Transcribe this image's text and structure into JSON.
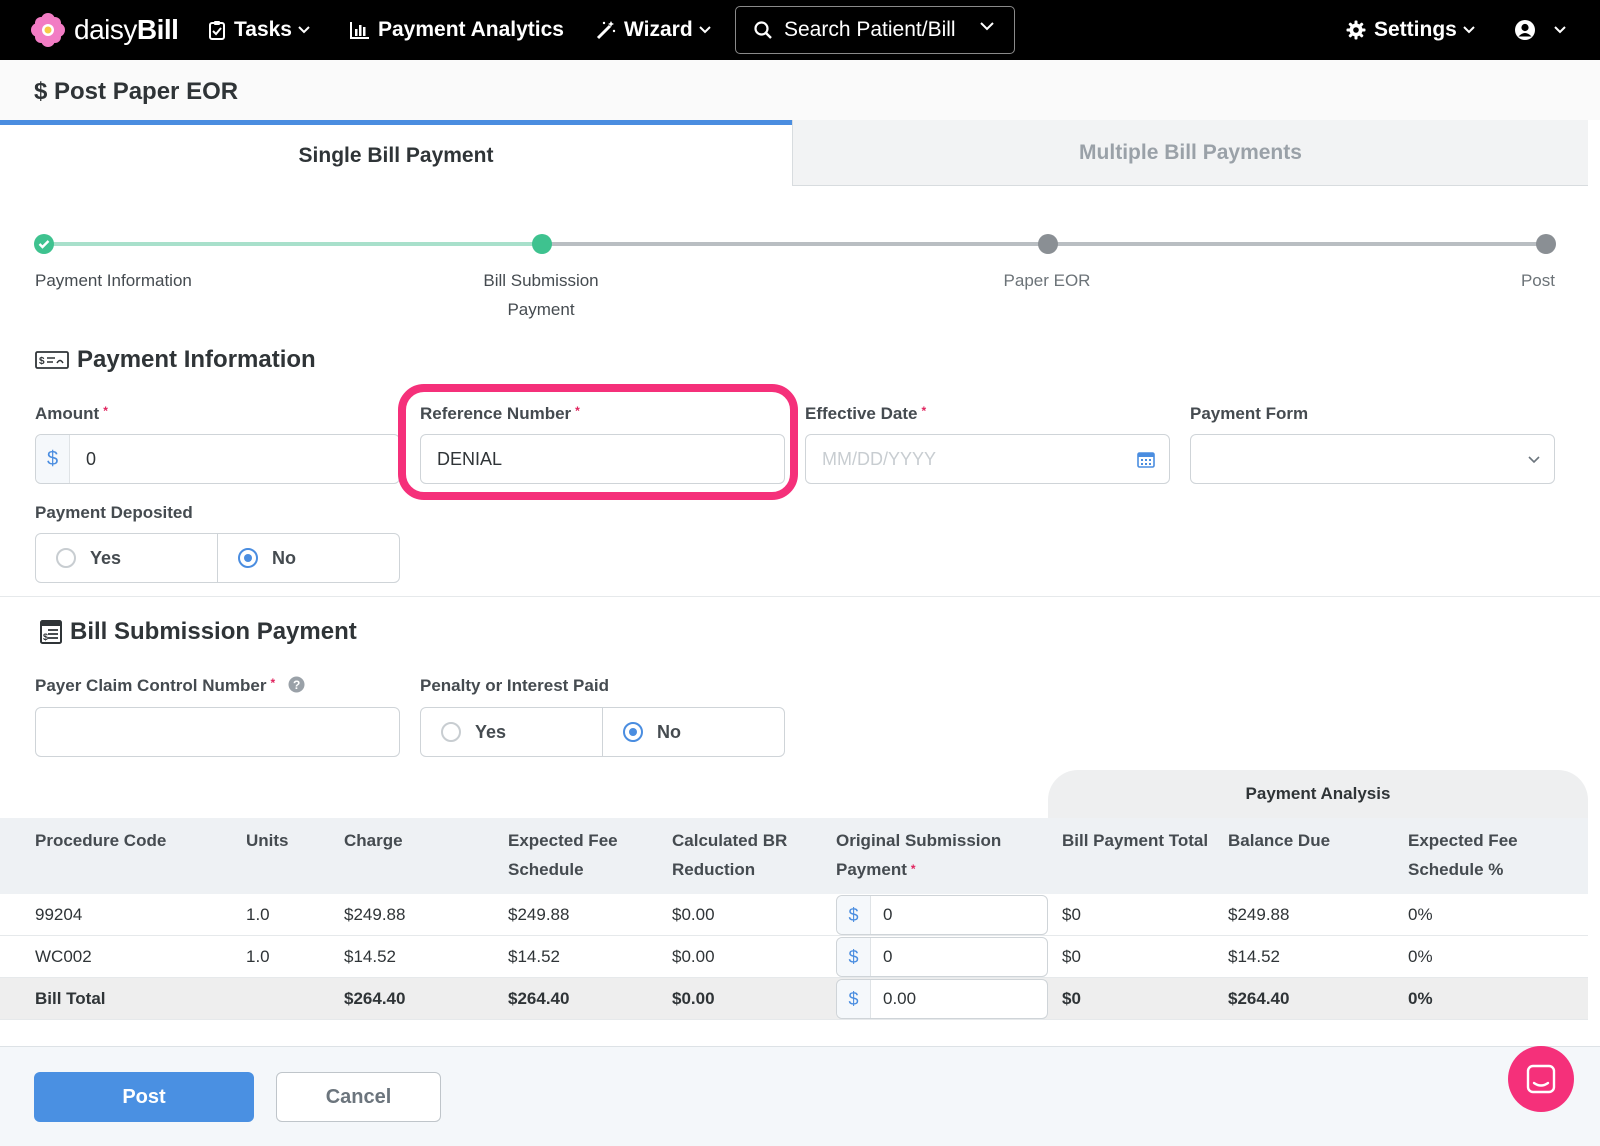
{
  "nav": {
    "brand_light": "daisy",
    "brand_bold": "Bill",
    "tasks": "Tasks",
    "payment_analytics": "Payment Analytics",
    "wizard": "Wizard",
    "search": "Search Patient/Bill",
    "settings": "Settings"
  },
  "page": {
    "title": "$ Post Paper EOR"
  },
  "tabs": [
    {
      "label": "Single Bill Payment",
      "active": true
    },
    {
      "label": "Multiple Bill Payments",
      "active": false
    }
  ],
  "stepper": {
    "steps": [
      {
        "label": "Payment Information",
        "state": "complete"
      },
      {
        "label": "Bill Submission",
        "label2": "Payment",
        "state": "current"
      },
      {
        "label": "Paper EOR",
        "state": "pending"
      },
      {
        "label": "Post",
        "state": "pending"
      }
    ],
    "colors": {
      "complete": "#3ec28f",
      "line_done": "#a8e0cb",
      "pending": "#8a8f94"
    }
  },
  "payment_info": {
    "title": "Payment Information",
    "amount": {
      "label": "Amount",
      "prefix": "$",
      "value": "0"
    },
    "reference": {
      "label": "Reference Number",
      "value": "DENIAL"
    },
    "effective_date": {
      "label": "Effective Date",
      "placeholder": "MM/DD/YYYY"
    },
    "payment_form": {
      "label": "Payment Form",
      "value": ""
    },
    "deposited": {
      "label": "Payment Deposited",
      "yes": "Yes",
      "no": "No",
      "selected": "No"
    }
  },
  "bill_submission": {
    "title": "Bill Submission Payment",
    "pccn": {
      "label": "Payer Claim Control Number",
      "value": ""
    },
    "penalty": {
      "label": "Penalty or Interest Paid",
      "yes": "Yes",
      "no": "No",
      "selected": "No"
    }
  },
  "table": {
    "payment_analysis": "Payment Analysis",
    "headers": {
      "code": "Procedure Code",
      "units": "Units",
      "charge": "Charge",
      "efs1": "Expected Fee",
      "efs2": "Schedule",
      "br1": "Calculated BR",
      "br2": "Reduction",
      "osp1": "Original Submission",
      "osp2": "Payment",
      "bpt": "Bill Payment Total",
      "bal": "Balance Due",
      "efsp1": "Expected Fee",
      "efsp2": "Schedule %"
    },
    "rows": [
      {
        "code": "99204",
        "units": "1.0",
        "charge": "$249.88",
        "efs": "$249.88",
        "br": "$0.00",
        "prefix": "$",
        "osp": "0",
        "bpt": "$0",
        "bal": "$249.88",
        "efsp": "0%"
      },
      {
        "code": "WC002",
        "units": "1.0",
        "charge": "$14.52",
        "efs": "$14.52",
        "br": "$0.00",
        "prefix": "$",
        "osp": "0",
        "bpt": "$0",
        "bal": "$14.52",
        "efsp": "0%"
      }
    ],
    "total": {
      "label": "Bill Total",
      "charge": "$264.40",
      "efs": "$264.40",
      "br": "$0.00",
      "prefix": "$",
      "osp": "0.00",
      "bpt": "$0",
      "bal": "$264.40",
      "efsp": "0%"
    }
  },
  "footer": {
    "post": "Post",
    "cancel": "Cancel"
  },
  "colors": {
    "accent": "#4a90e2",
    "highlight": "#f5307a",
    "required": "#e0245e"
  }
}
